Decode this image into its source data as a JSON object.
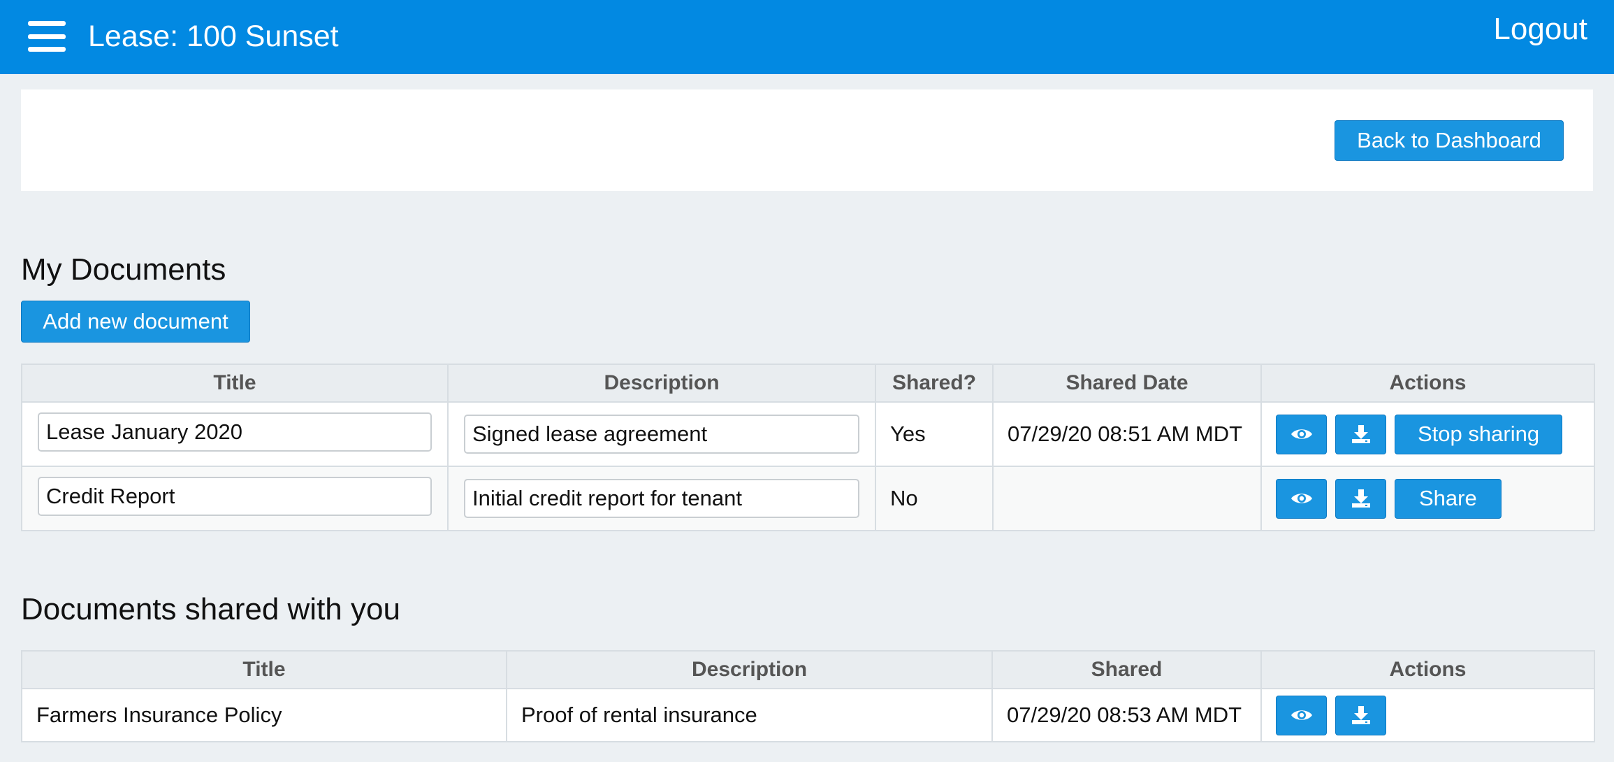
{
  "header": {
    "title": "Lease: 100 Sunset",
    "logout_label": "Logout",
    "menu_icon": "hamburger-menu-icon"
  },
  "panel": {
    "back_label": "Back to Dashboard"
  },
  "my_documents": {
    "heading": "My Documents",
    "add_label": "Add new document",
    "columns": [
      "Title",
      "Description",
      "Shared?",
      "Shared Date",
      "Actions"
    ],
    "rows": [
      {
        "title": "Lease January 2020",
        "description": "Signed lease agreement",
        "shared": "Yes",
        "shared_date": "07/29/20 08:51 AM MDT",
        "share_action_label": "Stop sharing"
      },
      {
        "title": "Credit Report",
        "description": "Initial credit report for tenant",
        "shared": "No",
        "shared_date": "",
        "share_action_label": "Share"
      }
    ]
  },
  "shared_with_you": {
    "heading": "Documents shared with you",
    "columns": [
      "Title",
      "Description",
      "Shared",
      "Actions"
    ],
    "rows": [
      {
        "title": "Farmers Insurance Policy",
        "description": "Proof of rental insurance",
        "shared": "07/29/20 08:53 AM MDT"
      }
    ]
  },
  "colors": {
    "header_bg": "#0289e2",
    "button_bg": "#1a95e0",
    "page_bg": "#ecf0f3"
  },
  "icons": {
    "view": "eye-icon",
    "download": "download-icon"
  }
}
